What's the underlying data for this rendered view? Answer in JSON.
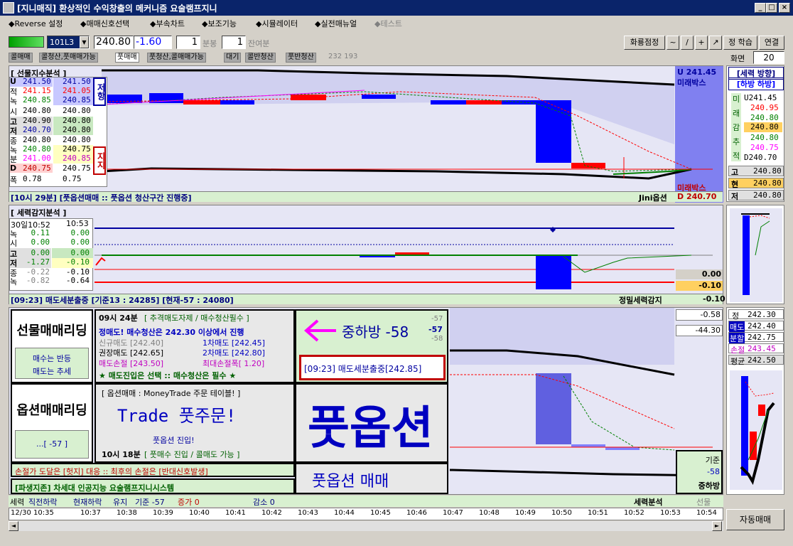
{
  "app": {
    "title": "[지니매직] 환상적인 수익창출의 메커니즘 요술램프지니"
  },
  "menu": [
    "◆Reverse 설정",
    "◆매매신호선택",
    "◆부속차트",
    "◆보조기능",
    "◆시뮬레이터",
    "◆실전매뉴얼",
    "◆테스트"
  ],
  "toolbar": {
    "symbol": "101L3",
    "price": "240.80",
    "change": "-1.60",
    "unit1": "1",
    "unit1_label": "분봉",
    "unit2": "1",
    "unit2_label": "잔여분",
    "btn_rate": "화룡점정",
    "btn_tilde": "~",
    "btn_slash": "/",
    "btn_plus": "+",
    "btn_arrow": "↗",
    "btn_learn": "정 학습",
    "btn_connect": "연결",
    "screen_label": "화면",
    "screen_value": "20"
  },
  "tabs": [
    "콜매매",
    "콜청산,풋매매가능",
    "풋매매",
    "풋청산,콜매매가능",
    "대기",
    "콜반청산",
    "풋반청산"
  ],
  "tabs_extra": "232 193",
  "top_panel": {
    "title": "[ 선물지수분석 ]",
    "rows": [
      {
        "k": "U",
        "a": "241.50",
        "b": "241.50"
      },
      {
        "k": "적",
        "a": "241.15",
        "b": "241.05"
      },
      {
        "k": "녹",
        "a": "240.85",
        "b": "240.85"
      },
      {
        "k": "시",
        "a": "240.80",
        "b": "240.80"
      },
      {
        "k": "고",
        "a": "240.90",
        "b": "240.80"
      },
      {
        "k": "저",
        "a": "240.70",
        "b": "240.80"
      },
      {
        "k": "종",
        "a": "240.80",
        "b": "240.80"
      },
      {
        "k": "녹",
        "a": "240.80",
        "b": "240.75"
      },
      {
        "k": "분",
        "a": "241.00",
        "b": "240.85"
      },
      {
        "k": "D",
        "a": "240.75",
        "b": "240.75"
      },
      {
        "k": "폭",
        "a": "0.78",
        "b": "0.75"
      }
    ],
    "resist": "저항",
    "support": "지지",
    "u_label": "U 241.45",
    "mirae1": "미래박스",
    "mirae2": "미래박스",
    "d_label": "D 240.70",
    "status": "[10시 29분] [풋옵션매매 :: 풋옵션 청산구간 진행중]",
    "jini": "Jini옵션"
  },
  "force": {
    "title": "[세력 방향]",
    "dir": "[하방 하방]",
    "vlabel": [
      "미",
      "래",
      "감",
      "추",
      "적"
    ],
    "vals": [
      "U241.45",
      "240.95",
      "240.80",
      "240.80",
      "240.80",
      "240.75",
      "D240.70"
    ],
    "go": "고",
    "go_v": "240.80",
    "hyun": "현",
    "hyun_v": "240.80",
    "jeo": "저",
    "jeo_v": "240.80"
  },
  "mid_panel": {
    "title": "[ 세력감지분석 ]",
    "date": "30일10:52",
    "time2": "10:53",
    "rows": [
      {
        "k": "녹",
        "a": "0.11",
        "b": "0.00"
      },
      {
        "k": "시",
        "a": "0.00",
        "b": "0.00"
      },
      {
        "k": "고",
        "a": "0.00",
        "b": "0.00"
      },
      {
        "k": "저",
        "a": "-1.27",
        "b": "-0.10"
      },
      {
        "k": "종",
        "a": "-0.22",
        "b": "-0.10"
      },
      {
        "k": "녹",
        "a": "-0.82",
        "b": "-0.64"
      }
    ],
    "v1": "0.00",
    "v2": "-0.10",
    "v3": "-0.10",
    "status": "[09:23] 매도세분출중 [기준13 : 24285] [현재-57 : 24080]",
    "precise": "정밀세력감지"
  },
  "trade": {
    "futures_title": "선물매매리딩",
    "futures_l1": "매수는 반등",
    "futures_l2": "매도는 추세",
    "option_title": "옵션매매리딩",
    "option_val": "...[ -57 ]",
    "time_head": "09시 24분",
    "time_head2": "[ 추격매도자제 / 매수청산필수 ]",
    "sig1": "정매도! 매수청산은 242.30 이상에서 진행",
    "sig2a": "신규매도 [242.40]",
    "sig2b": "1차매도 [242.45]",
    "sig3a": "권장매도 [242.65]",
    "sig3b": "2차매도 [242.80]",
    "sig4a": "매도손절 [243.50]",
    "sig4b": "최대손절폭[ 1.20]",
    "sig5": "★ 매도진입은 선택  ::  매수청산은 필수 ★",
    "dir_text": "중하방 -58",
    "dir_n1": "-57",
    "dir_n2": "-57",
    "dir_n3": "-58",
    "alert": "[09:23] 매도세분출중[242.85]",
    "opt_head": "[ 옵션매매 : MoneyTrade 주문 테이블! ]",
    "trade_big": "Trade 풋주문!",
    "put_entry": "풋옵션 진입!",
    "time2": "10시 18분",
    "time2b": "[ 풋매수 진입 /  콜매도 가능  ]",
    "big": "풋옵션",
    "big_sub": "풋옵션 매매",
    "loss": "손절가 도달은 [헛지] 대응 :: 최후의 손절은 [반대신호발생]",
    "ai": "[파생지존] 차세대 인공지능 요술램프지니시스템",
    "v_a": "-0.58",
    "v_b": "-44.30",
    "base_lbl": "기준",
    "base_v": "-58",
    "base_dir": "중하방"
  },
  "right_bottom": {
    "jung": "정",
    "jung_v": "242.30",
    "sell": "매도",
    "sell_v": "242.40",
    "split": "분할",
    "split_v": "242.75",
    "cut": "손절",
    "cut_v": "243.45",
    "avg": "평균",
    "avg_v": "242.50"
  },
  "bottom_status": {
    "a": "세력",
    "b": "직전하락",
    "c": "현재하락",
    "d": "유지",
    "e": "기준 -57",
    "f": "증가 0",
    "g": "감소 0",
    "h": "세력분석",
    "i": "선물"
  },
  "time_axis": [
    "12/30 10:35",
    "10:37",
    "10:38",
    "10:39",
    "10:40",
    "10:41",
    "10:42",
    "10:43",
    "10:44",
    "10:45",
    "10:46",
    "10:47",
    "10:48",
    "10:49",
    "10:50",
    "10:51",
    "10:52",
    "10:53",
    "10:54"
  ],
  "auto_btn": "자동매매",
  "colors": {
    "title": "#0a246a",
    "candle_blue": "#0000ff",
    "candle_red": "#ff0000",
    "green": "#d8f0d0"
  }
}
